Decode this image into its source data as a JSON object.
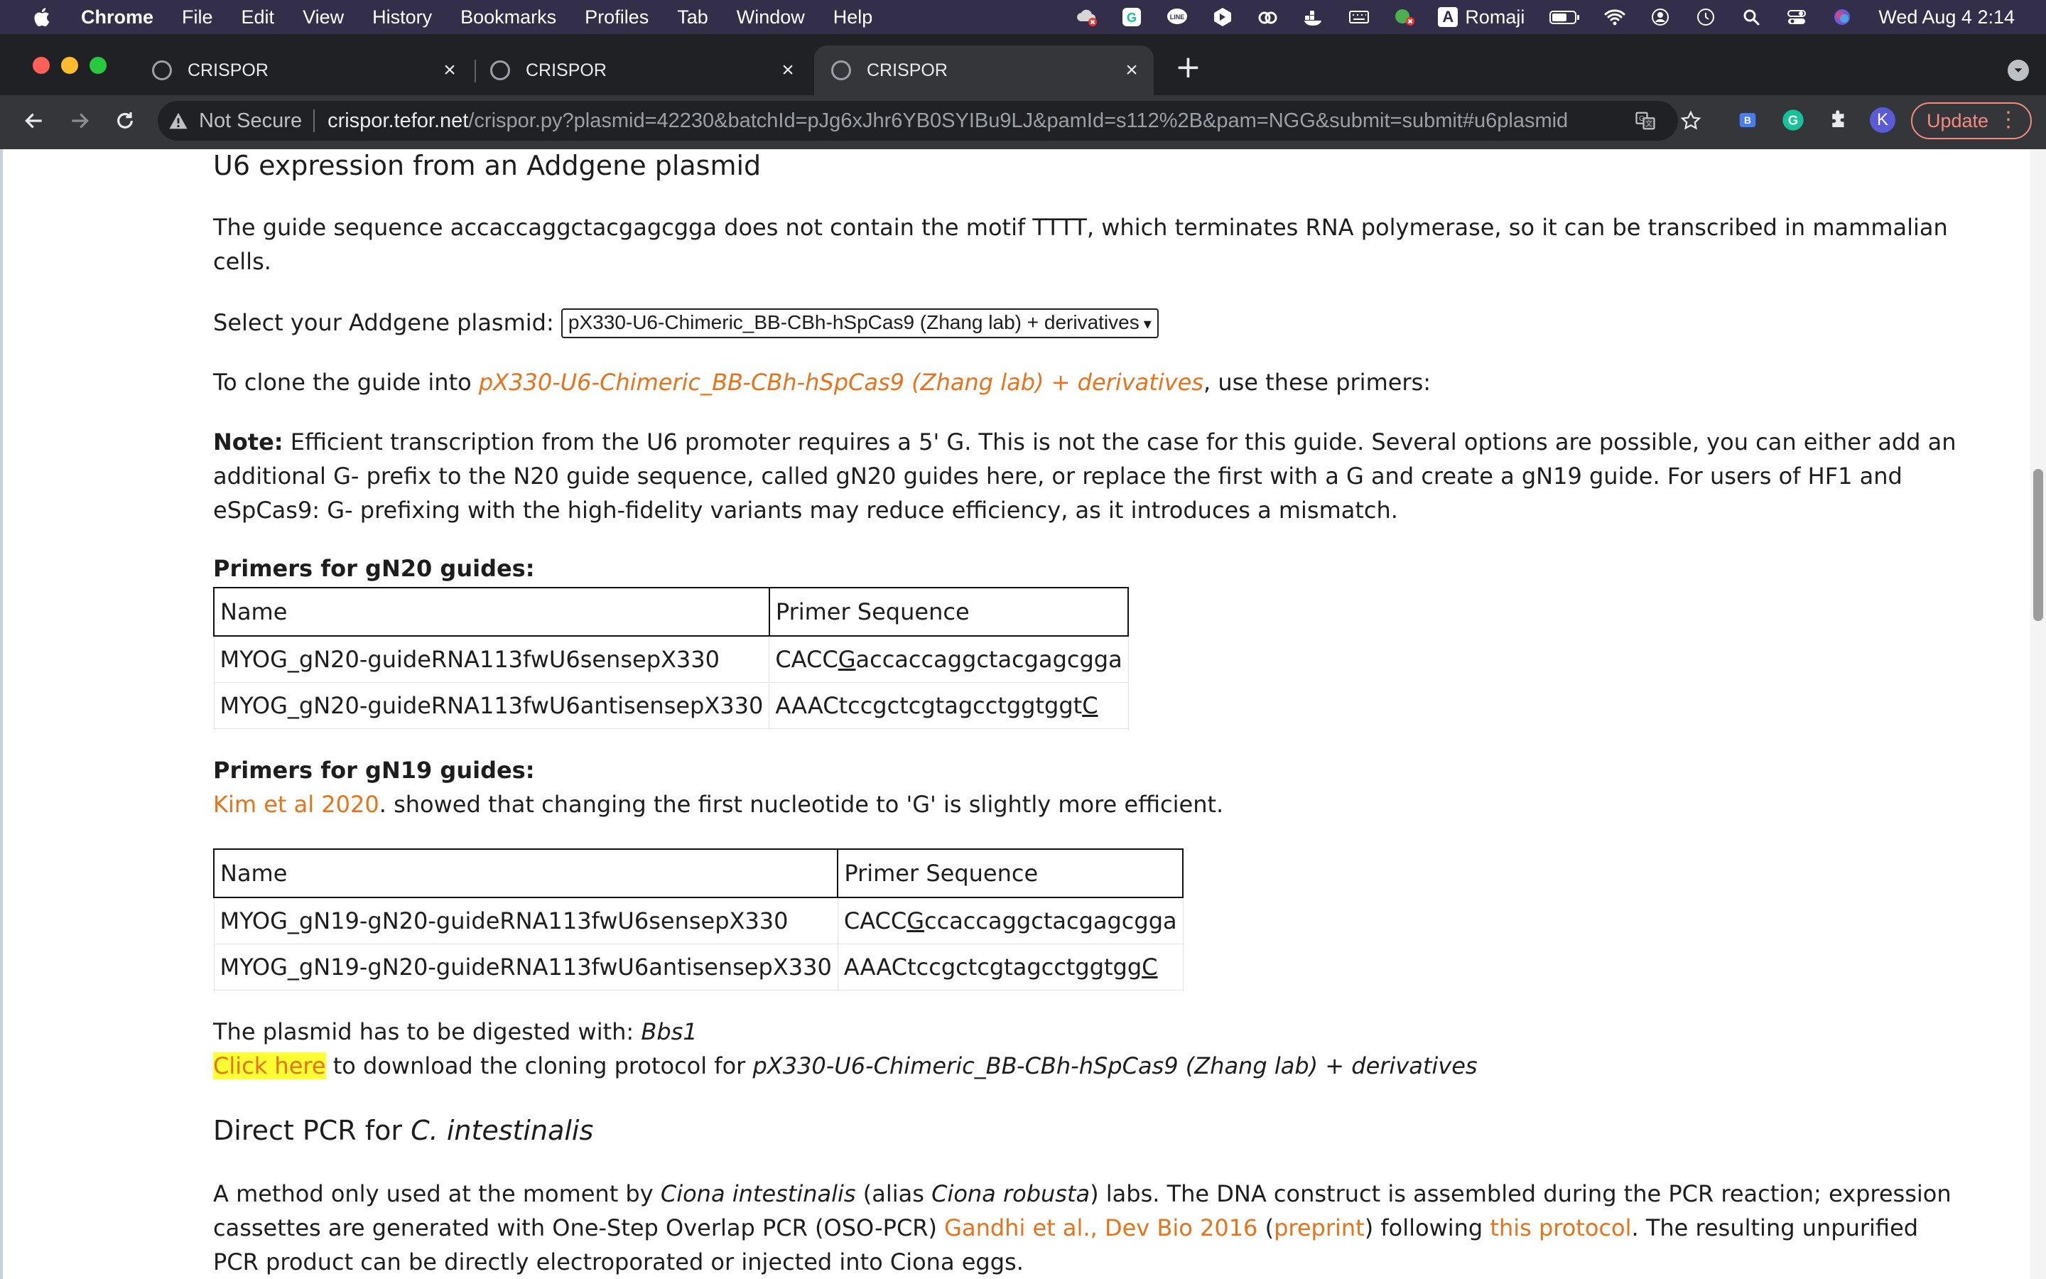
{
  "menubar": {
    "app": "Chrome",
    "items": [
      "File",
      "Edit",
      "View",
      "History",
      "Bookmarks",
      "Profiles",
      "Tab",
      "Window",
      "Help"
    ],
    "input_source": "Romaji",
    "input_letter": "A",
    "clock": "Wed Aug 4  2:14"
  },
  "tabs": [
    {
      "title": "CRISPOR"
    },
    {
      "title": "CRISPOR"
    },
    {
      "title": "CRISPOR"
    }
  ],
  "toolbar": {
    "security": "Not Secure",
    "url_host": "crispor.tefor.net",
    "url_path": "/crispor.py?plasmid=42230&batchId=pJg6xJhr6YB0SYIBu9LJ&pamId=s112%2B&pam=NGG&submit=submit#u6plasmid",
    "profile_initial": "K",
    "update_label": "Update"
  },
  "page": {
    "section1_title": "U6 expression from an Addgene plasmid",
    "intro_1": "The guide sequence accaccaggctacgagcgga does not contain the motif TTTT, which terminates RNA polymerase, so it can be transcribed in mammalian",
    "intro_2": "cells.",
    "select_label": "Select your Addgene plasmid:",
    "select_value": "pX330-U6-Chimeric_BB-CBh-hSpCas9 (Zhang lab) + derivatives",
    "clone_prefix": "To clone the guide into ",
    "clone_link": "pX330-U6-Chimeric_BB-CBh-hSpCas9 (Zhang lab) + derivatives",
    "clone_suffix": ", use these primers:",
    "note_label": "Note:",
    "note_1": " Efficient transcription from the U6 promoter requires a 5' G. This is not the case for this guide. Several options are possible, you can either add an",
    "note_2": "additional G- prefix to the N20 guide sequence, called gN20 guides here, or replace the first with a G and create a gN19 guide. For users of HF1 and",
    "note_3": "eSpCas9: G- prefixing with the high-fidelity variants may reduce efficiency, as it introduces a mismatch.",
    "gn20_heading": "Primers for gN20 guides:",
    "gn20_table": {
      "headers": [
        "Name",
        "Primer Sequence"
      ],
      "rows": [
        {
          "name": "MYOG_gN20-guideRNA113fwU6sensepX330",
          "seq_a": "CACC",
          "seq_u": "G",
          "seq_b": "accaccaggctacgagcgga"
        },
        {
          "name": "MYOG_gN20-guideRNA113fwU6antisensepX330",
          "seq_a": "AAACtccgctcgtagcctggtggt",
          "seq_u": "C",
          "seq_b": ""
        }
      ]
    },
    "gn19_heading": "Primers for gN19 guides:",
    "kim_link": "Kim et al 2020",
    "kim_text": ". showed that changing the first nucleotide to 'G' is slightly more efficient.",
    "gn19_table": {
      "headers": [
        "Name",
        "Primer Sequence"
      ],
      "rows": [
        {
          "name": "MYOG_gN19-gN20-guideRNA113fwU6sensepX330",
          "seq_a": "CACC",
          "seq_u": "G",
          "seq_b": "ccaccaggctacgagcgga"
        },
        {
          "name": "MYOG_gN19-gN20-guideRNA113fwU6antisensepX330",
          "seq_a": "AAACtccgctcgtagcctggtgg",
          "seq_u": "C",
          "seq_b": ""
        }
      ]
    },
    "digest_prefix": "The plasmid has to be digested with: ",
    "digest_enzyme": "Bbs1",
    "click_here": "Click here",
    "download_text": " to download the cloning protocol for ",
    "download_plasmid": "pX330-U6-Chimeric_BB-CBh-hSpCas9 (Zhang lab) + derivatives",
    "section2_title_a": "Direct PCR for ",
    "section2_title_b": "C. intestinalis",
    "pcr_1a": "A method only used at the moment by ",
    "pcr_1b": "Ciona intestinalis",
    "pcr_1c": " (alias ",
    "pcr_1d": "Ciona robusta",
    "pcr_1e": ") labs. The DNA construct is assembled during the PCR reaction; expression",
    "pcr_2a": "cassettes are generated with One-Step Overlap PCR (OSO-PCR) ",
    "pcr_2link1": "Gandhi et al., Dev Bio 2016",
    "pcr_2b": " (",
    "pcr_2link2": "preprint",
    "pcr_2c": ") following ",
    "pcr_2link3": "this protocol",
    "pcr_2d": ". The resulting unpurified",
    "pcr_3": "PCR product can be directly electroporated or injected into Ciona eggs."
  }
}
